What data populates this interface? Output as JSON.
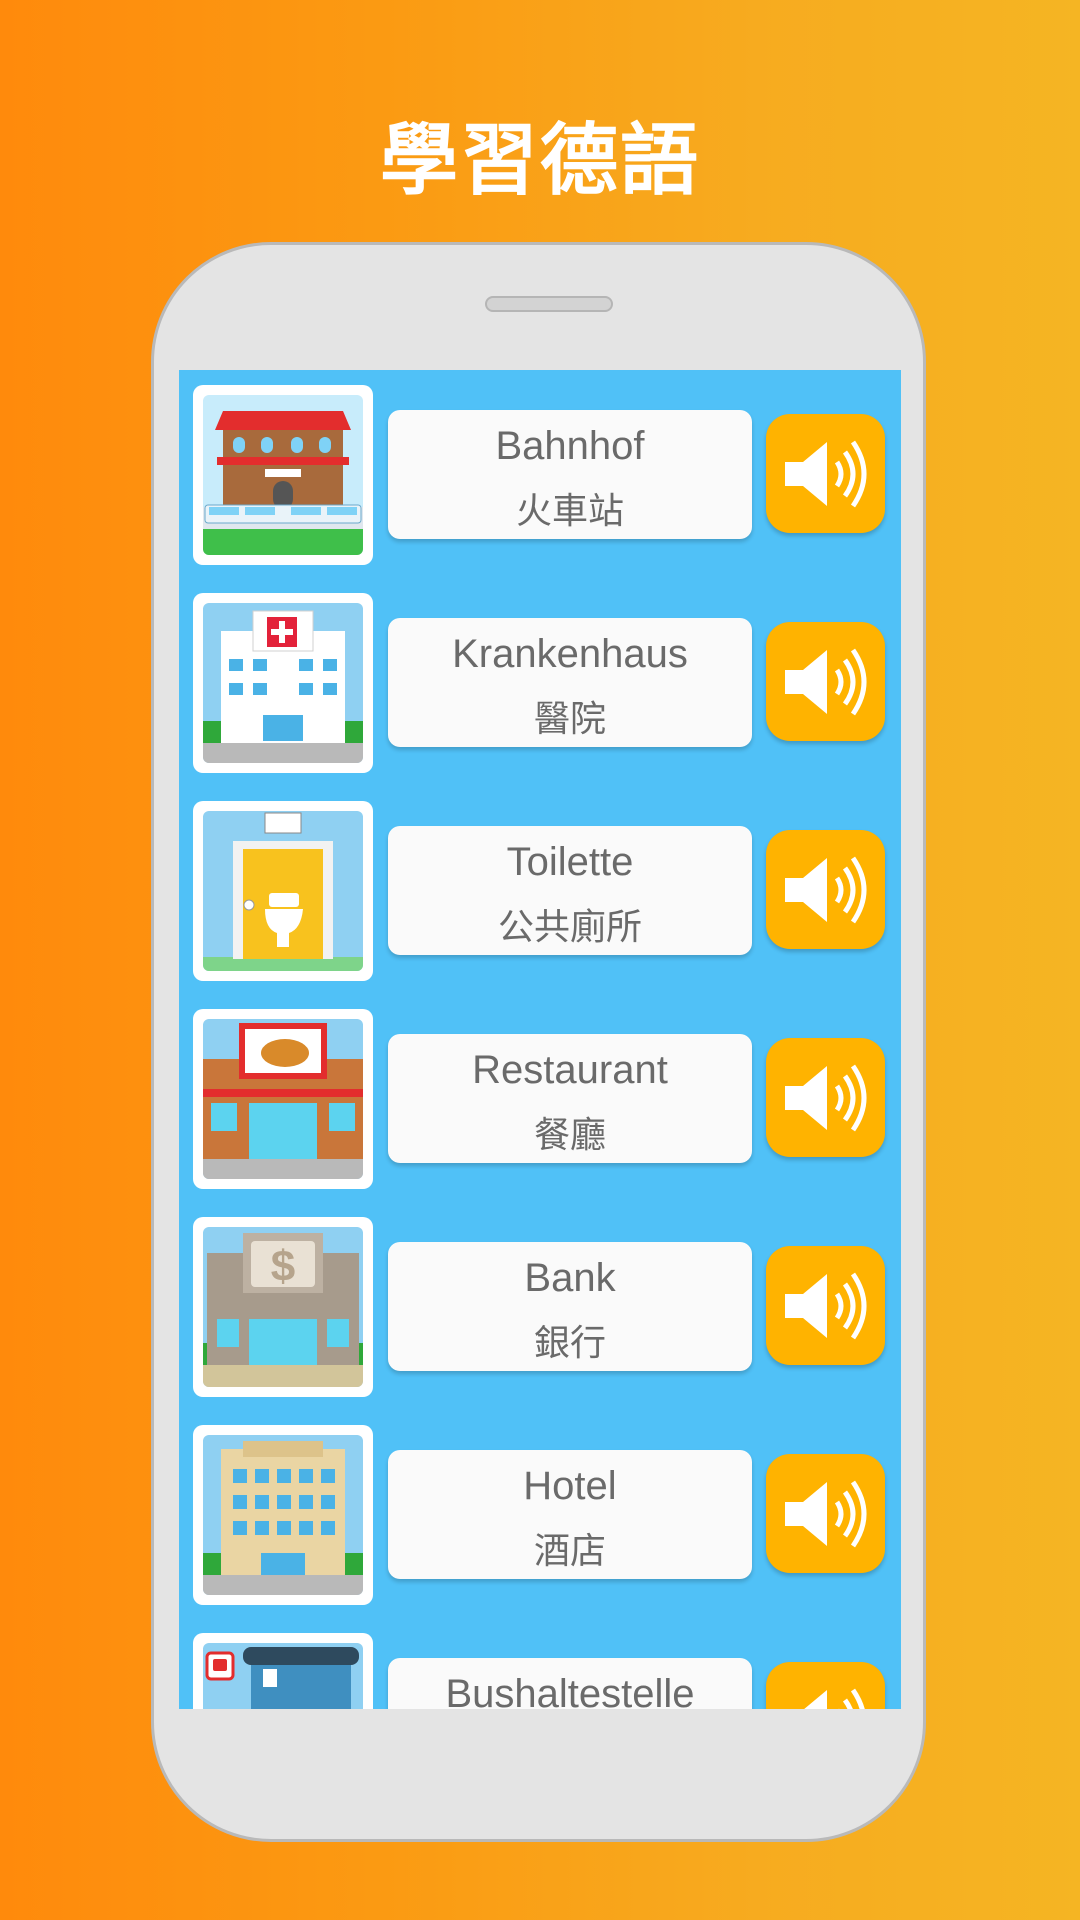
{
  "header": {
    "title": "學習德語"
  },
  "colors": {
    "background_left": "#ff8a0c",
    "background_right": "#f5b523",
    "screen": "#50c1f7",
    "audio_button": "#ffb300"
  },
  "vocab_list": [
    {
      "german": "Bahnhof",
      "chinese": "火車站",
      "image_icon": "train-station-icon"
    },
    {
      "german": "Krankenhaus",
      "chinese": "醫院",
      "image_icon": "hospital-icon"
    },
    {
      "german": "Toilette",
      "chinese": "公共廁所",
      "image_icon": "toilet-icon"
    },
    {
      "german": "Restaurant",
      "chinese": "餐廳",
      "image_icon": "restaurant-icon"
    },
    {
      "german": "Bank",
      "chinese": "銀行",
      "image_icon": "bank-icon"
    },
    {
      "german": "Hotel",
      "chinese": "酒店",
      "image_icon": "hotel-icon"
    },
    {
      "german": "Bushaltestelle",
      "chinese": "",
      "image_icon": "bus-stop-icon"
    }
  ],
  "audio_icon": "speaker-icon"
}
